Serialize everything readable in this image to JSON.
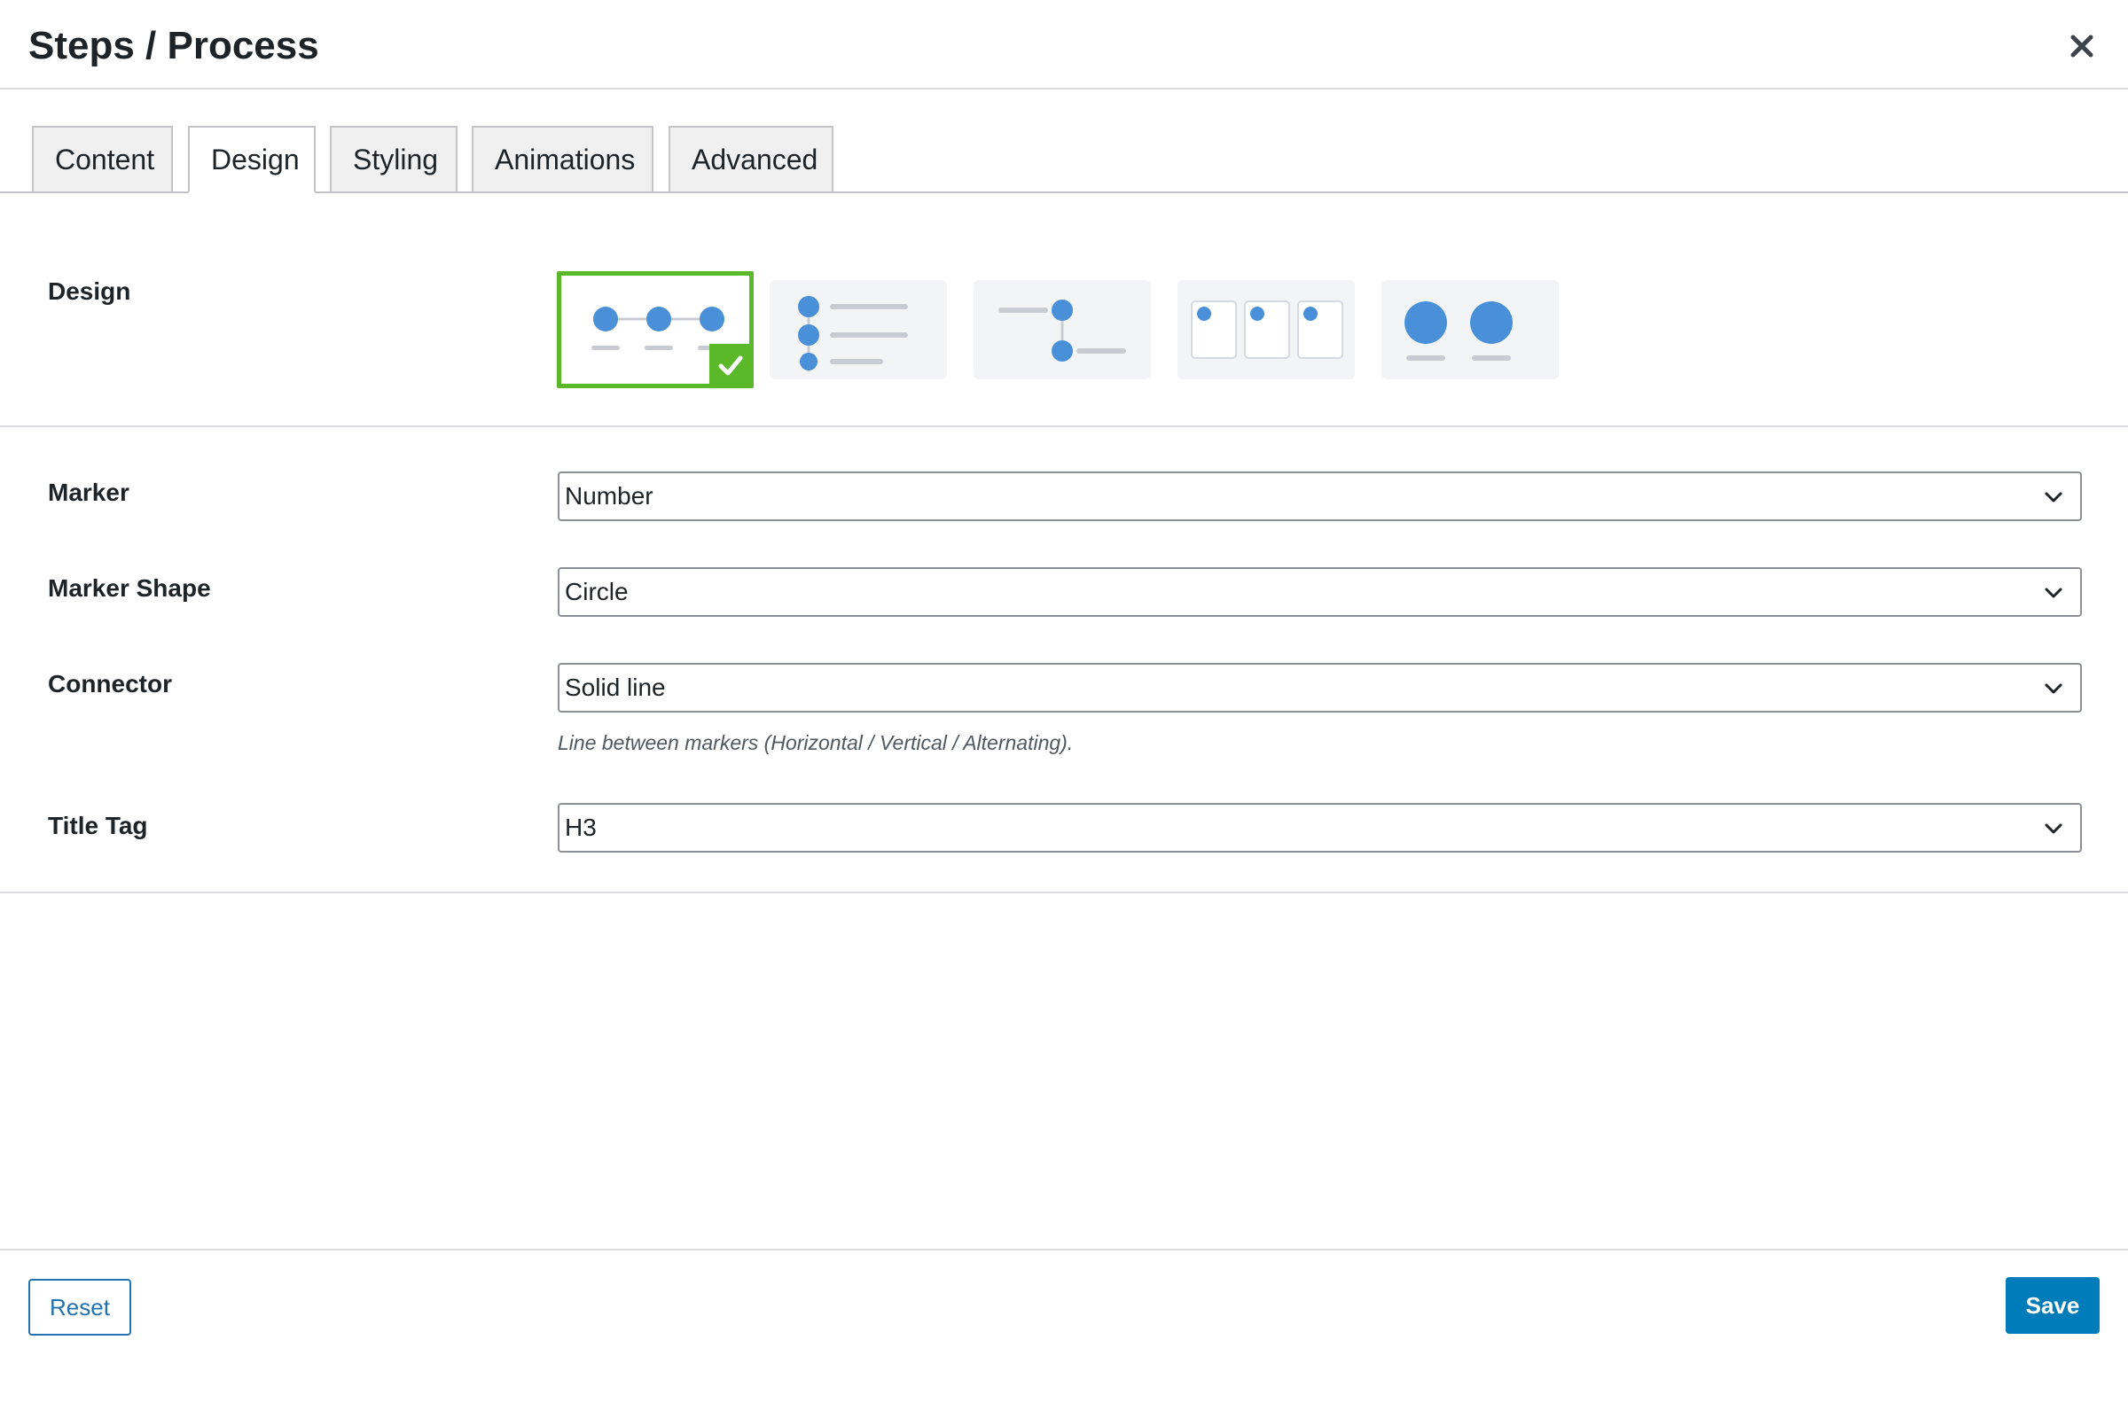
{
  "modal": {
    "title": "Steps / Process",
    "close_icon": "close-icon"
  },
  "tabs": [
    {
      "label": "Content",
      "active": false
    },
    {
      "label": "Design",
      "active": true
    },
    {
      "label": "Styling",
      "active": false
    },
    {
      "label": "Animations",
      "active": false
    },
    {
      "label": "Advanced",
      "active": false
    }
  ],
  "design": {
    "label": "Design",
    "options": [
      {
        "icon": "horizontal-steps-icon",
        "selected": true
      },
      {
        "icon": "vertical-list-icon",
        "selected": false
      },
      {
        "icon": "alternating-steps-icon",
        "selected": false
      },
      {
        "icon": "card-steps-icon",
        "selected": false
      },
      {
        "icon": "large-circles-icon",
        "selected": false
      }
    ],
    "check_icon": "checkmark-icon"
  },
  "fields": {
    "marker": {
      "label": "Marker",
      "value": "Number"
    },
    "marker_shape": {
      "label": "Marker Shape",
      "value": "Circle"
    },
    "connector": {
      "label": "Connector",
      "value": "Solid line",
      "help": "Line between markers (Horizontal / Vertical / Alternating)."
    },
    "title_tag": {
      "label": "Title Tag",
      "value": "H3"
    }
  },
  "footer": {
    "reset_label": "Reset",
    "save_label": "Save"
  },
  "colors": {
    "accent_blue": "#4a90d9",
    "selected_green": "#5ab829",
    "primary_button": "#007cba",
    "link_blue": "#2271b1"
  }
}
